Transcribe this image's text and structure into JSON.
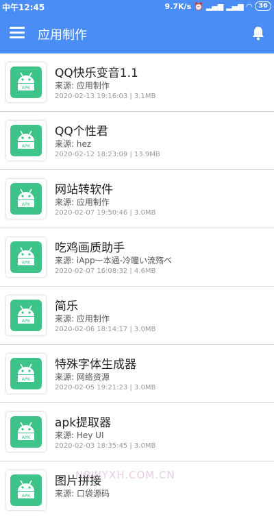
{
  "status_bar": {
    "time": "中午12:45",
    "net_speed": "9.7K/s",
    "battery": "36"
  },
  "toolbar": {
    "title": "应用制作"
  },
  "apps": [
    {
      "name": "QQ快乐变音1.1",
      "source": "来源: 应用制作",
      "meta": "2020-02-13 19:16:03 | 3.1MB"
    },
    {
      "name": "QQ个性君",
      "source": "来源: hez",
      "meta": "2020-02-12 18:23:09 | 13.9MB"
    },
    {
      "name": "网站转软件",
      "source": "来源: 应用制作",
      "meta": "2020-02-07 19:50:46 | 3.0MB"
    },
    {
      "name": "吃鸡画质助手",
      "source": "来源: iApp一本通-冷瞳い流殇べ",
      "meta": "2020-02-07 16:08:32 | 4.6MB"
    },
    {
      "name": "简乐",
      "source": "来源: 应用制作",
      "meta": "2020-02-06 18:14:17 | 3.0MB"
    },
    {
      "name": "特殊字体生成器",
      "source": "来源: 网络资源",
      "meta": "2020-02-05 19:21:23 | 3.0MB"
    },
    {
      "name": "apk提取器",
      "source": "来源: Hey UI",
      "meta": "2020-02-03 18:35:45 | 3.0MB"
    },
    {
      "name": "图片拼接",
      "source": "来源: 口袋源码",
      "meta": ""
    }
  ],
  "apk_badge": "APK",
  "watermark": "NBWYXH.COM.CN",
  "colors": {
    "accent": "#4a8df4",
    "apk_green": "#3ec48a"
  }
}
